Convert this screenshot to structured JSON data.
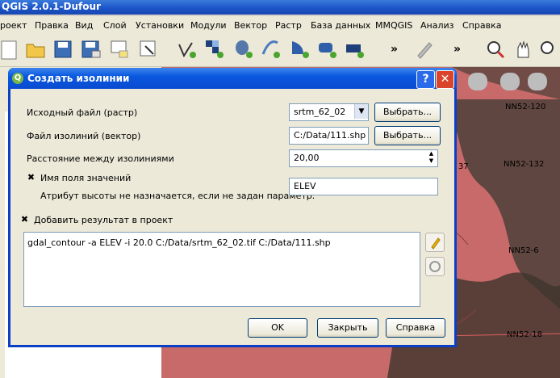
{
  "app": {
    "title": "QGIS 2.0.1-Dufour"
  },
  "menu": [
    "роект",
    "Правка",
    "Вид",
    "Слой",
    "Установки",
    "Модули",
    "Вектор",
    "Растр",
    "База данных",
    "MMQGIS",
    "Анализ",
    "Справка"
  ],
  "toolbar": {
    "more": "»"
  },
  "map": {
    "labels": [
      "NN52-120",
      "NN52-132",
      "NN52-6",
      "NN52-18",
      "37"
    ]
  },
  "dialog": {
    "title": "Создать изолинии",
    "help_label": "?",
    "close_label": "✕",
    "input_file_label": "Исходный файл (растр)",
    "input_file_value": "srtm_62_02",
    "browse1": "Выбрать...",
    "output_file_label": "Файл изолиний (вектор)",
    "output_file_value": "C:/Data/111.shp",
    "browse2": "Выбрать...",
    "interval_label": "Расстояние между изолиниями",
    "interval_value": "20,00",
    "attr_checkbox_label": "Имя поля значений",
    "attr_note": "Атрибут высоты не назначается, если не задан параметр.",
    "attr_value": "ELEV",
    "add_result_label": "Добавить результат в проект",
    "command": "gdal_contour -a ELEV -i 20.0 C:/Data/srtm_62_02.tif C:/Data/111.shp",
    "ok": "OK",
    "close": "Закрыть",
    "help": "Справка"
  }
}
